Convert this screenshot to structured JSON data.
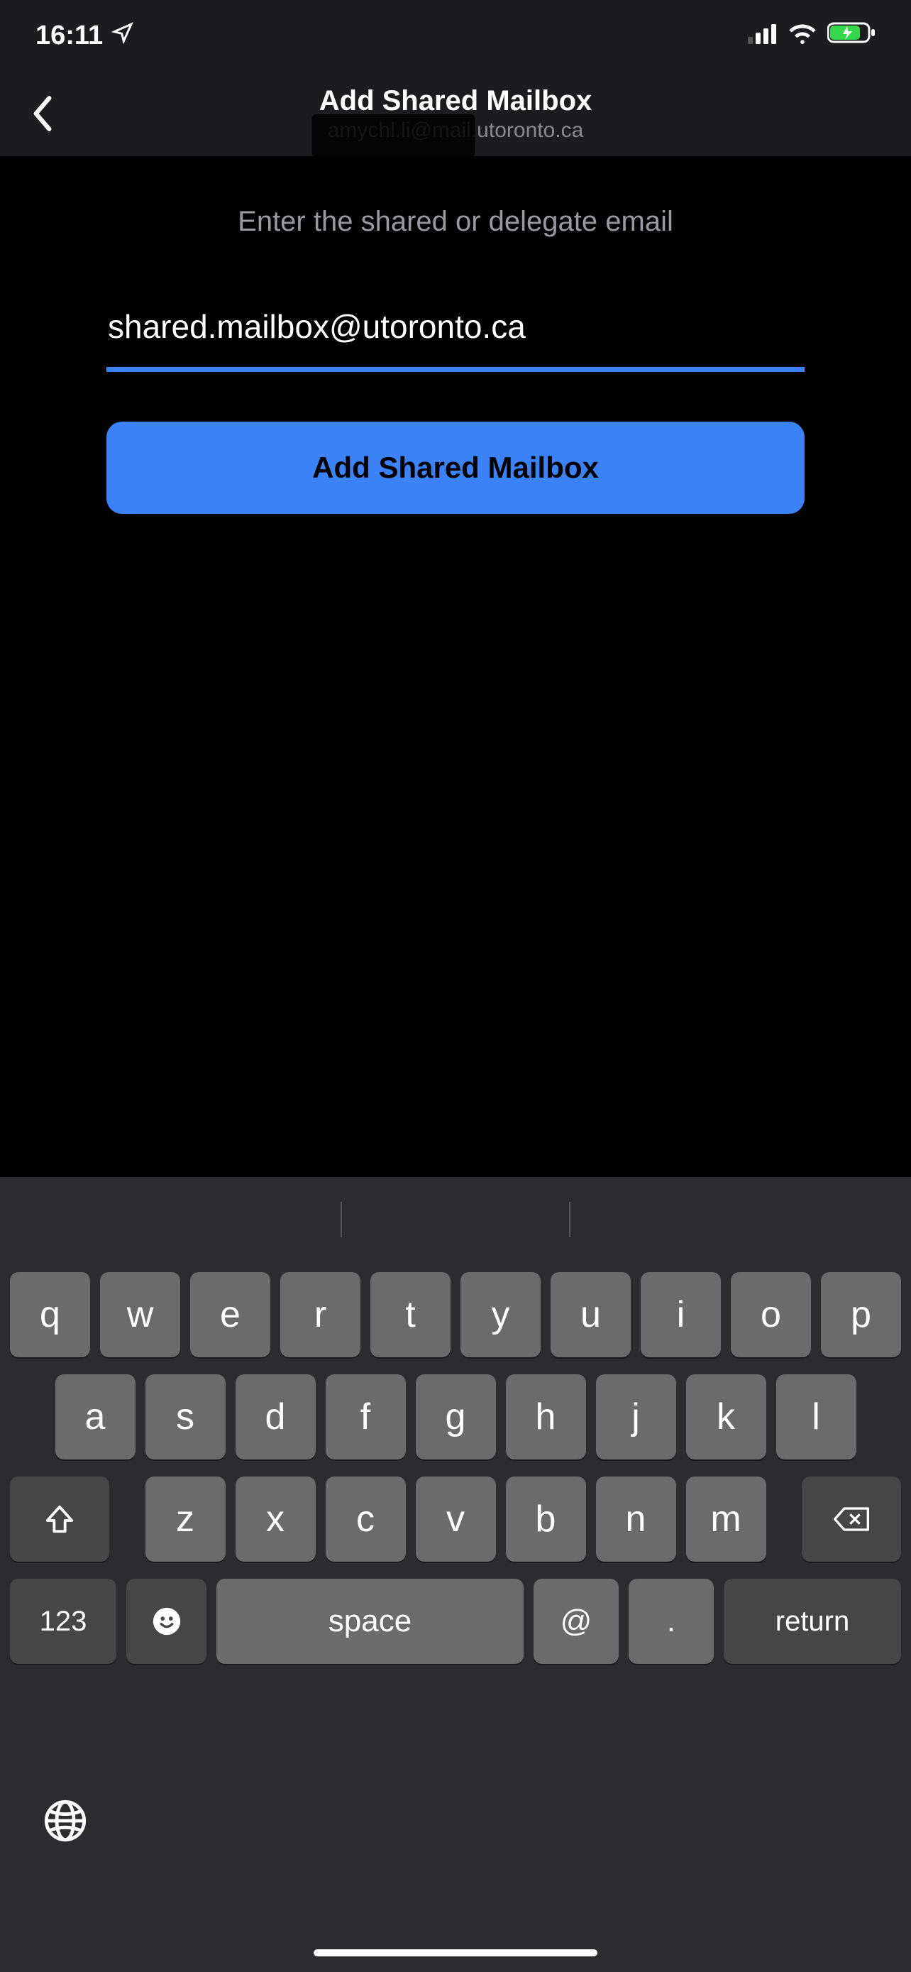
{
  "status": {
    "time": "16:11"
  },
  "nav": {
    "title": "Add Shared Mailbox",
    "subtitle": "amychl.li@mail.utoronto.ca"
  },
  "form": {
    "prompt": "Enter the shared or delegate email",
    "email_value": "shared.mailbox@utoronto.ca",
    "submit_label": "Add Shared Mailbox"
  },
  "keyboard": {
    "row1": [
      "q",
      "w",
      "e",
      "r",
      "t",
      "y",
      "u",
      "i",
      "o",
      "p"
    ],
    "row2": [
      "a",
      "s",
      "d",
      "f",
      "g",
      "h",
      "j",
      "k",
      "l"
    ],
    "row3": [
      "z",
      "x",
      "c",
      "v",
      "b",
      "n",
      "m"
    ],
    "numbers_label": "123",
    "space_label": "space",
    "at_label": "@",
    "dot_label": ".",
    "return_label": "return"
  }
}
